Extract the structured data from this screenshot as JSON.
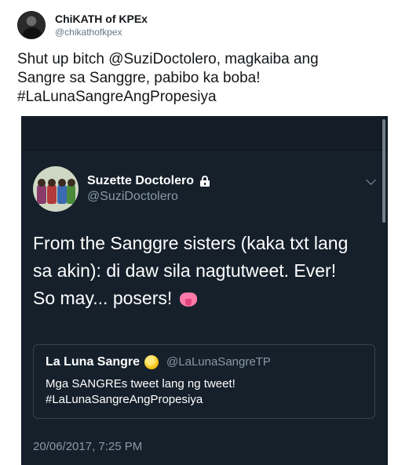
{
  "author": {
    "display_name": "ChiKATH of KPEx",
    "handle": "@chikathofkpex"
  },
  "tweet": {
    "lines": [
      "Shut up bitch @SuziDoctolero, magkaiba ang",
      "Sangre sa Sanggre, pabibo ka boba!",
      "#LaLunaSangreAngPropesiya"
    ]
  },
  "embedded": {
    "author": {
      "display_name": "Suzette Doctolero",
      "handle": "@SuziDoctolero"
    },
    "text_lines": [
      "From the Sanggre sisters (kaka txt lang",
      "sa akin): di daw sila nagtutweet.  Ever!",
      "So may... posers!"
    ],
    "quoted": {
      "display_name": "La Luna Sangre",
      "handle": "@LaLunaSangreTP",
      "lines": [
        "Mga SANGREs tweet lang ng tweet!",
        "#LaLunaSangreAngPropesiya"
      ]
    },
    "timestamp": "20/06/2017, 7:25 PM"
  },
  "colors": {
    "dark_bg": "#15202b",
    "muted": "#8899a6",
    "text_dark": "#14171a"
  },
  "icons": [
    "user-avatar",
    "lock-icon",
    "chevron-down-icon",
    "verified-icon",
    "tongue-emoji-icon"
  ]
}
